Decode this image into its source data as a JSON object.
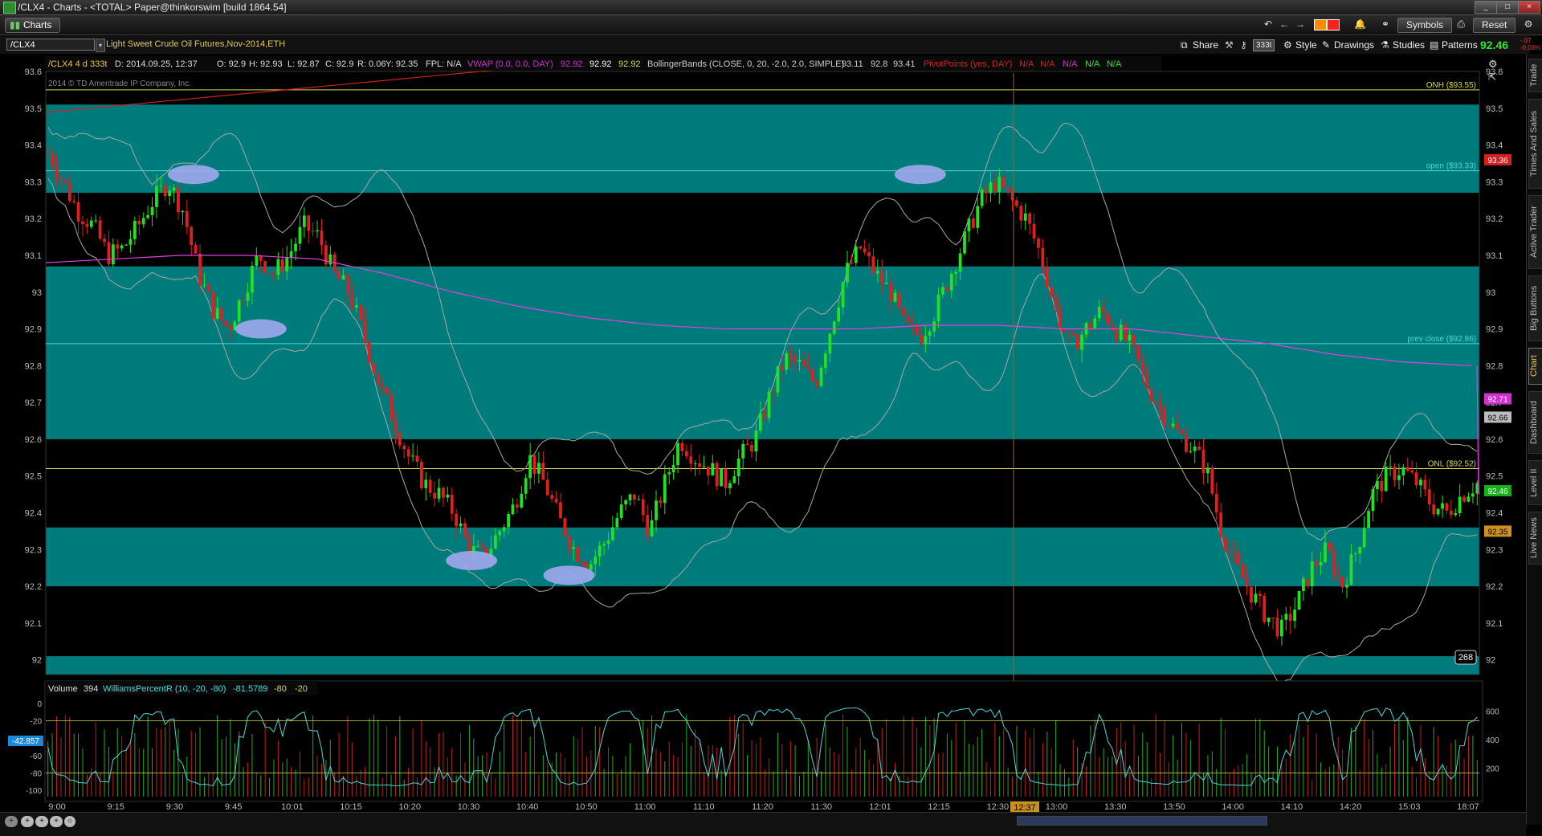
{
  "window": {
    "title": "/CLX4 - Charts - <TOTAL> Paper@thinkorswim [build 1864.54]",
    "controls": [
      "_",
      "□",
      "×"
    ]
  },
  "tabbar": {
    "tab_label": "Charts",
    "color_swatches": [
      "#ff8c00",
      "#ff2020"
    ],
    "symbols_label": "Symbols",
    "reset_label": "Reset"
  },
  "symbol_bar": {
    "symbol": "/CLX4",
    "description": "Light Sweet Crude Oil Futures,Nov-2014,ETH",
    "share_label": "Share",
    "aggregation_label": "333t",
    "style_label": "Style",
    "drawings_label": "Drawings",
    "studies_label": "Studies",
    "patterns_label": "Patterns",
    "last_price": "92.46",
    "change_1": "-.07",
    "change_2": "-0.08%"
  },
  "side_tabs": [
    "Trade",
    "Times And Sales",
    "Active Trader",
    "Big Buttons",
    "Chart",
    "Dashboard",
    "Level II",
    "Live News"
  ],
  "chart_header": {
    "symbol_agg": "/CLX4 4 d 333t",
    "date": "D: 2014.09.25, 12:37",
    "open": "O: 92.9",
    "high": "H: 92.93",
    "low": "L: 92.87",
    "close": "C: 92.9",
    "range": "R: 0.06",
    "y": "Y: 92.35",
    "fpl": "FPL: N/A",
    "vwap_label": "VWAP (0.0, 0.0, DAY)",
    "vwap_values": [
      "92.92",
      "92.92",
      "92.92"
    ],
    "bb_label": "BollingerBands (CLOSE, 0, 20, -2.0, 2.0, SIMPLE)",
    "bb_values": [
      "93.11",
      "92.8",
      "93.41"
    ],
    "pivot_label": "PivotPoints (yes, DAY)",
    "pivot_values": [
      "N/A",
      "N/A",
      "N/A",
      "N/A",
      "N/A"
    ],
    "copyright": "2014 © TD Ameritrade IP Company, Inc."
  },
  "chart_data": {
    "type": "candlestick",
    "price_axis": {
      "ylim": [
        91.96,
        93.6
      ],
      "ticks": [
        "93.6",
        "93.5",
        "93.4",
        "93.3",
        "93.2",
        "93.1",
        "93",
        "92.9",
        "92.8",
        "92.7",
        "92.6",
        "92.5",
        "92.4",
        "92.3",
        "92.2",
        "92.1",
        "92"
      ]
    },
    "time_labels": [
      "9:00",
      "9:15",
      "9:30",
      "9:45",
      "10:01",
      "10:15",
      "10:20",
      "10:30",
      "10:40",
      "10:50",
      "11:00",
      "11:10",
      "11:20",
      "11:30",
      "12:01",
      "12:15",
      "12:30",
      "13:00",
      "13:30",
      "13:50",
      "14:00",
      "14:10",
      "14:20",
      "15:03",
      "18:07"
    ],
    "cursor_time": "12:37",
    "bands": [
      {
        "from": 93.51,
        "to": 93.27,
        "color": "#007b7b"
      },
      {
        "from": 93.07,
        "to": 92.6,
        "color": "#007b7b"
      },
      {
        "from": 92.36,
        "to": 92.2,
        "color": "#007b7b"
      },
      {
        "from": 92.01,
        "to": 91.9,
        "color": "#007b7b"
      }
    ],
    "levels": [
      {
        "label": "ONH ($93.55)",
        "value": 93.55,
        "color": "#d8d84a"
      },
      {
        "label": "open ($93.33)",
        "value": 93.33,
        "color": "#4ad8d8"
      },
      {
        "label": "prev close ($92.86)",
        "value": 92.86,
        "color": "#4ad8d8"
      },
      {
        "label": "ONL ($92.52)",
        "value": 92.52,
        "color": "#d8d84a"
      }
    ],
    "price_tags": [
      {
        "text": "93.36",
        "value": 93.36,
        "bg": "#d42020",
        "fg": "#fff"
      },
      {
        "text": "92.71",
        "value": 92.71,
        "bg": "#d030d0",
        "fg": "#fff"
      },
      {
        "text": "92.66",
        "value": 92.66,
        "bg": "#bdbdbd",
        "fg": "#000"
      },
      {
        "text": "92.46",
        "value": 92.46,
        "bg": "#18b018",
        "fg": "#fff"
      },
      {
        "text": "92.35",
        "value": 92.35,
        "bg": "#d09020",
        "fg": "#000"
      }
    ],
    "bar_count_badge": "268",
    "close_path": [
      93.38,
      93.3,
      93.22,
      93.18,
      93.1,
      93.12,
      93.18,
      93.25,
      93.3,
      93.22,
      93.05,
      92.95,
      92.9,
      93.0,
      93.1,
      93.05,
      93.1,
      93.18,
      93.15,
      93.05,
      93.0,
      92.88,
      92.75,
      92.65,
      92.55,
      92.48,
      92.45,
      92.4,
      92.3,
      92.28,
      92.35,
      92.42,
      92.55,
      92.48,
      92.38,
      92.3,
      92.26,
      92.32,
      92.4,
      92.45,
      92.35,
      92.48,
      92.6,
      92.55,
      92.52,
      92.48,
      92.55,
      92.6,
      92.72,
      92.82,
      92.8,
      92.75,
      92.9,
      93.05,
      93.12,
      93.05,
      93.0,
      92.9,
      92.88,
      92.95,
      93.05,
      93.15,
      93.25,
      93.3,
      93.25,
      93.2,
      93.1,
      92.95,
      92.85,
      92.9,
      92.95,
      92.9,
      92.85,
      92.75,
      92.68,
      92.62,
      92.58,
      92.52,
      92.35,
      92.25,
      92.18,
      92.12,
      92.08,
      92.15,
      92.25,
      92.3,
      92.2,
      92.3,
      92.45,
      92.5,
      92.52,
      92.48,
      92.42,
      92.4,
      92.45,
      92.48
    ],
    "vwap": [
      93.08,
      93.09,
      93.1,
      93.1,
      93.09,
      93.05,
      93.0,
      92.96,
      92.93,
      92.91,
      92.9,
      92.9,
      92.9,
      92.91,
      92.91,
      92.9,
      92.9,
      92.88,
      92.86,
      92.83,
      92.81,
      92.8
    ],
    "markers": [
      {
        "t": 0.103,
        "v": 93.32
      },
      {
        "t": 0.15,
        "v": 92.9
      },
      {
        "t": 0.297,
        "v": 92.27
      },
      {
        "t": 0.365,
        "v": 92.23
      },
      {
        "t": 0.61,
        "v": 93.32
      }
    ],
    "study_header": {
      "volume_label": "Volume",
      "volume_value": "394",
      "wpr_label": "WilliamsPercentR (10, -20, -80)",
      "wpr_value": "-81.5789",
      "wpr_levels": [
        "-80",
        "-20"
      ]
    },
    "wpr_axis": [
      "0",
      "-20",
      "-40",
      "-60",
      "-80",
      "-100"
    ],
    "volume_axis": [
      "600",
      "400",
      "200"
    ],
    "wpr_current": "-42.857"
  },
  "nav": [
    "+",
    "+",
    "+",
    "+",
    "○"
  ]
}
